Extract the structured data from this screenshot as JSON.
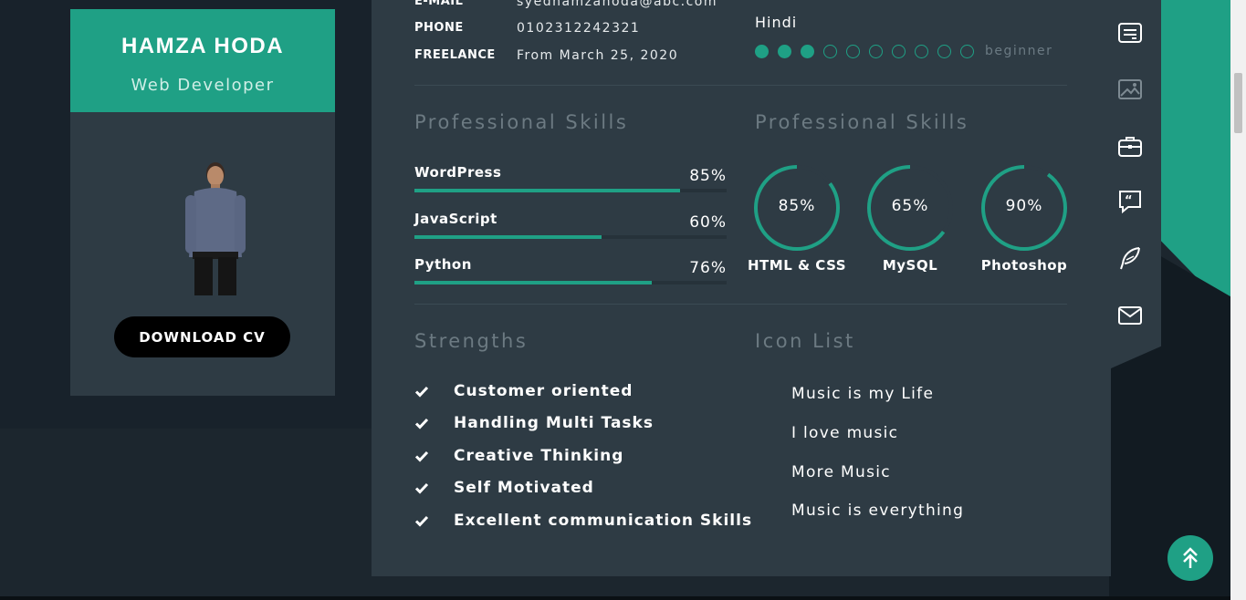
{
  "profile": {
    "name": "HAMZA HODA",
    "role": "Web Developer",
    "download_label": "DOWNLOAD CV"
  },
  "info": [
    {
      "label": "E-MAIL",
      "value": "syedhamzahoda@abc.com"
    },
    {
      "label": "PHONE",
      "value": "0102312242321"
    },
    {
      "label": "FREELANCE",
      "value": "From March 25, 2020"
    }
  ],
  "language": {
    "name": "Hindi",
    "level_text": "beginner",
    "filled": 3,
    "total": 10
  },
  "professional_skills": {
    "title": "Professional Skills",
    "bars": [
      {
        "name": "WordPress",
        "pct_label": "85%",
        "value": 85
      },
      {
        "name": "JavaScript",
        "pct_label": "60%",
        "value": 60
      },
      {
        "name": "Python",
        "pct_label": "76%",
        "value": 76
      }
    ]
  },
  "professional_skills_circles": {
    "title": "Professional Skills",
    "items": [
      {
        "name": "HTML & CSS",
        "pct_label": "85%",
        "value": 85
      },
      {
        "name": "MySQL",
        "pct_label": "65%",
        "value": 65
      },
      {
        "name": "Photoshop",
        "pct_label": "90%",
        "value": 90
      }
    ]
  },
  "strengths": {
    "title": "Strengths",
    "items": [
      "Customer oriented",
      "Handling Multi Tasks",
      "Creative Thinking",
      "Self Motivated",
      "Excellent communication Skills"
    ]
  },
  "icon_list": {
    "title": "Icon List",
    "items": [
      "Music is my Life",
      "I love music",
      "More Music",
      "Music is everything"
    ]
  },
  "side_nav": [
    "resume-icon",
    "portfolio-image-icon",
    "briefcase-icon",
    "quote-bubble-icon",
    "feather-icon",
    "envelope-icon"
  ],
  "colors": {
    "accent": "#1fa085",
    "panel": "#2e3b44",
    "background": "#1c262e"
  }
}
